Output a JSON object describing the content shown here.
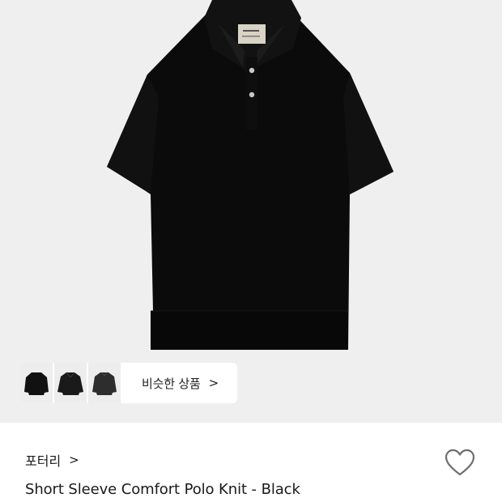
{
  "product": {
    "brand": "포터리",
    "brand_chevron": ">",
    "title": "Short Sleeve Comfort Polo Knit - Black",
    "image_background": "#efefef",
    "garment_color": "#0c0c0c"
  },
  "similar": {
    "label": "비슷한 상품",
    "chevron": ">",
    "thumbnails": [
      "black-sweater-thumb",
      "black-sweater-thumb",
      "dark-gray-sweater-thumb"
    ]
  },
  "icons": {
    "like": "heart-outline-icon"
  }
}
